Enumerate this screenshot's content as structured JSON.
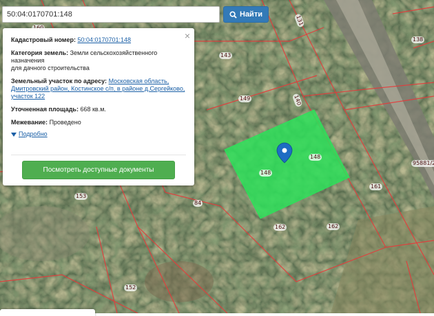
{
  "search": {
    "value": "50:04:0170701:148",
    "button_label": "Найти"
  },
  "popup": {
    "cadastral_number_label": "Кадастровый номер:",
    "cadastral_number_value": "50:04:0170701:148",
    "land_category_label": "Категория земель:",
    "land_category_value": "Земли сельскохозяйственного назначения",
    "land_use_value": "для дачного строительства",
    "address_label": "Земельный участок по адресу:",
    "address_value": "Московская область, Дмитровский район, Костинское с/п, в районе д.Сергейково, участок 122",
    "area_label": "Уточненная площадь:",
    "area_value": "668 кв.м.",
    "survey_label": "Межевание:",
    "survey_value": "Проведено",
    "details_link": "Подробно",
    "docs_button": "Посмотреть доступные документы",
    "close_symbol": "×"
  },
  "map": {
    "plot_labels": [
      "148",
      "149",
      "143",
      "140",
      "148",
      "153",
      "84",
      "162",
      "162",
      "161",
      "138",
      "131",
      "95881/2",
      "152",
      "160"
    ],
    "highlight_color": "#2ee05a",
    "boundary_color": "#e63a3a"
  }
}
